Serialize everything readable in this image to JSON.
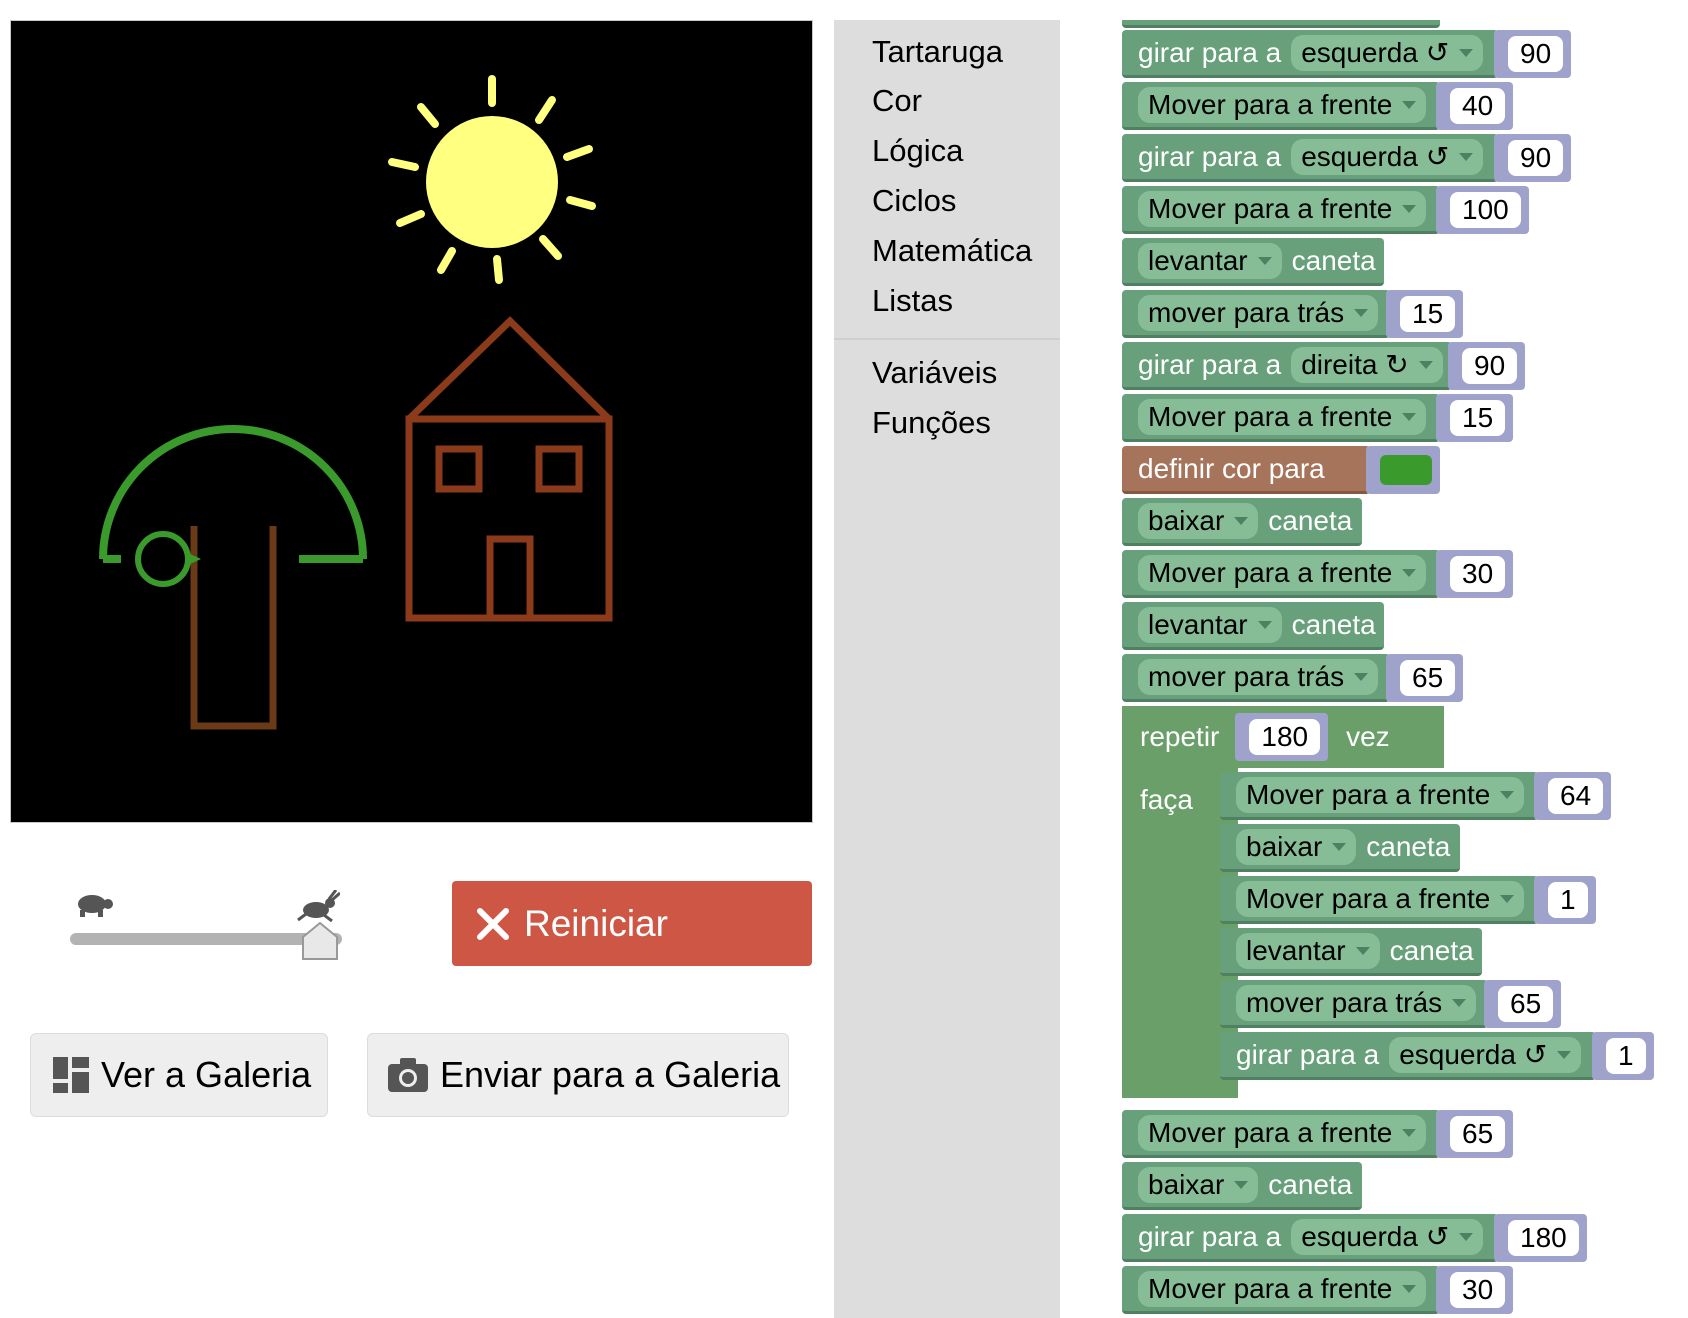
{
  "toolbox": {
    "categories": [
      "Tartaruga",
      "Cor",
      "Lógica",
      "Ciclos",
      "Matemática",
      "Listas"
    ],
    "extra": [
      "Variáveis",
      "Funções"
    ]
  },
  "controls": {
    "run_label": "Reiniciar",
    "view_gallery_label": "Ver a Galeria",
    "send_gallery_label": "Enviar para a Galeria",
    "speed": 0.95
  },
  "colors": {
    "run_button": "#cd5744",
    "turtle_block": "#67a07a",
    "colour_block": "#a5745b",
    "loop_block": "#6a9f6a",
    "pen_green": "#3a9a2b",
    "sun": "#ffff80",
    "house": "#8b3a1a",
    "trunk": "#6b3a16"
  },
  "blocks": [
    {
      "kind": "turn",
      "label": "girar para a",
      "dir": "esquerda ↺",
      "value": "90"
    },
    {
      "kind": "move",
      "label": "Mover para a frente",
      "value": "40"
    },
    {
      "kind": "turn",
      "label": "girar para a",
      "dir": "esquerda ↺",
      "value": "90"
    },
    {
      "kind": "move",
      "label": "Mover para a frente",
      "value": "100"
    },
    {
      "kind": "pen",
      "label": "levantar",
      "tail": "caneta"
    },
    {
      "kind": "move",
      "label": "mover para trás",
      "value": "15"
    },
    {
      "kind": "turn",
      "label": "girar para a",
      "dir": "direita ↻",
      "value": "90"
    },
    {
      "kind": "move",
      "label": "Mover para a frente",
      "value": "15"
    },
    {
      "kind": "colour",
      "label": "definir cor para"
    },
    {
      "kind": "pen",
      "label": "baixar",
      "tail": "caneta"
    },
    {
      "kind": "move",
      "label": "Mover para a frente",
      "value": "30"
    },
    {
      "kind": "pen",
      "label": "levantar",
      "tail": "caneta"
    },
    {
      "kind": "move",
      "label": "mover para trás",
      "value": "65"
    }
  ],
  "loop": {
    "repeat_label": "repetir",
    "times": "180",
    "times_suffix": "vez",
    "do_label": "faça",
    "body": [
      {
        "kind": "move",
        "label": "Mover para a frente",
        "value": "64"
      },
      {
        "kind": "pen",
        "label": "baixar",
        "tail": "caneta"
      },
      {
        "kind": "move",
        "label": "Mover para a frente",
        "value": "1"
      },
      {
        "kind": "pen",
        "label": "levantar",
        "tail": "caneta"
      },
      {
        "kind": "move",
        "label": "mover para trás",
        "value": "65"
      },
      {
        "kind": "turn",
        "label": "girar para a",
        "dir": "esquerda ↺",
        "value": "1"
      }
    ]
  },
  "after_loop": [
    {
      "kind": "move",
      "label": "Mover para a frente",
      "value": "65"
    },
    {
      "kind": "pen",
      "label": "baixar",
      "tail": "caneta"
    },
    {
      "kind": "turn",
      "label": "girar para a",
      "dir": "esquerda ↺",
      "value": "180"
    },
    {
      "kind": "move",
      "label": "Mover para a frente",
      "value": "30"
    }
  ]
}
